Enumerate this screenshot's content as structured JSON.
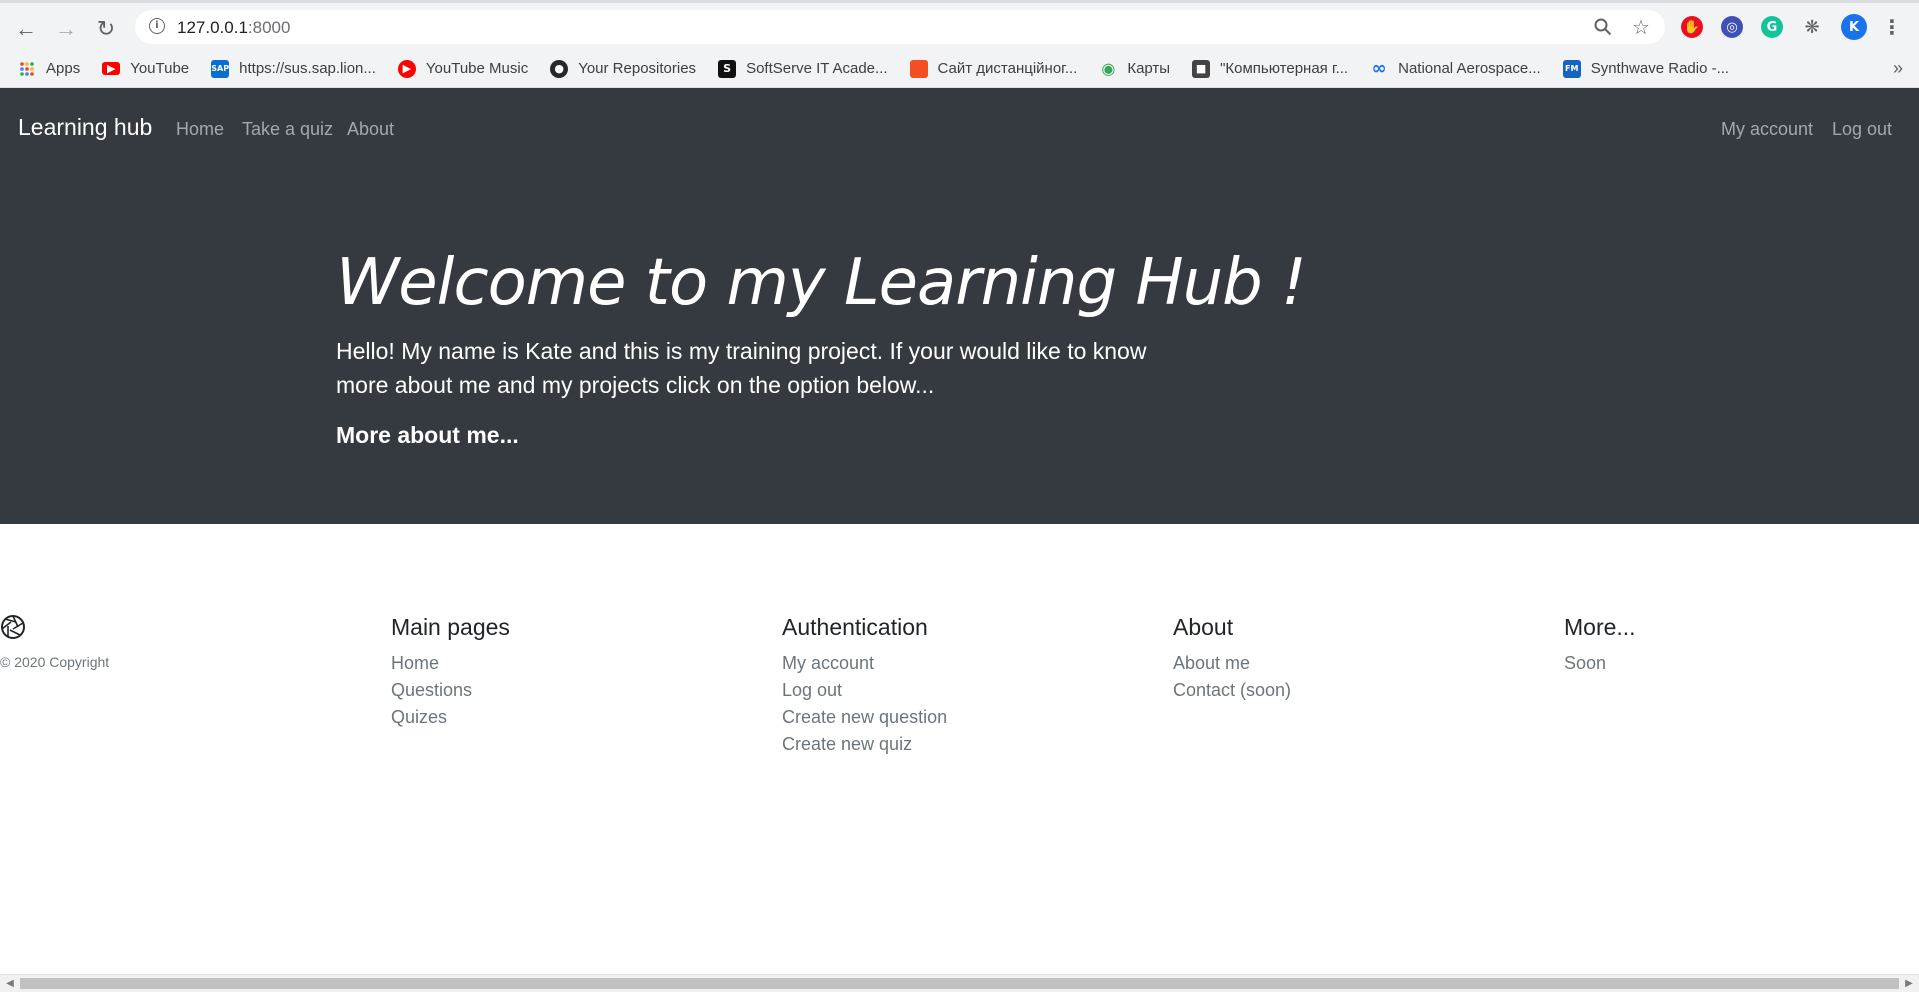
{
  "browser": {
    "url_host": "127.0.0.1",
    "url_port": ":8000",
    "bookmarks": [
      {
        "label": "Apps",
        "icon": "apps-grid-icon",
        "color": "#ea4335"
      },
      {
        "label": "YouTube",
        "icon": "youtube-icon",
        "color": "#ff0000"
      },
      {
        "label": "https://sus.sap.lion...",
        "icon": "sap-icon",
        "color": "#0a6ed1"
      },
      {
        "label": "YouTube Music",
        "icon": "youtube-music-icon",
        "color": "#ff0000"
      },
      {
        "label": "Your Repositories",
        "icon": "github-icon",
        "color": "#24292e"
      },
      {
        "label": "SoftServe IT Acade...",
        "icon": "softserve-icon",
        "color": "#111111"
      },
      {
        "label": "Сайт дистанційног...",
        "icon": "site-orange-icon",
        "color": "#f25022"
      },
      {
        "label": "Карты",
        "icon": "maps-pin-icon",
        "color": "#34a853"
      },
      {
        "label": "\"Компьютерная г...",
        "icon": "classroom-icon",
        "color": "#444444"
      },
      {
        "label": "National Aerospace...",
        "icon": "infinity-icon",
        "color": "#1a73e8"
      },
      {
        "label": "Synthwave Radio -...",
        "icon": "radio-fm-icon",
        "color": "#1565c0"
      }
    ],
    "profile_initial": "K"
  },
  "nav": {
    "brand": "Learning hub",
    "links": [
      "Home",
      "Take a quiz",
      "About"
    ],
    "right_links": [
      "My account",
      "Log out"
    ]
  },
  "hero": {
    "title": "Welcome to my Learning Hub !",
    "text": "Hello! My name is Kate and this is my training project. If your would like to know more about me and my projects click on the option below...",
    "link": "More about me..."
  },
  "footer": {
    "copyright": "© 2020 Copyright",
    "columns": [
      {
        "title": "Main pages",
        "links": [
          "Home",
          "Questions",
          "Quizes"
        ]
      },
      {
        "title": "Authentication",
        "links": [
          "My account",
          "Log out",
          "Create new question",
          "Create new quiz"
        ]
      },
      {
        "title": "About",
        "links": [
          "About me",
          "Contact (soon)"
        ]
      },
      {
        "title": "More...",
        "links": [
          "Soon"
        ]
      }
    ]
  },
  "colors": {
    "navbar_bg": "#343a40",
    "link_muted": "#6c757d"
  }
}
